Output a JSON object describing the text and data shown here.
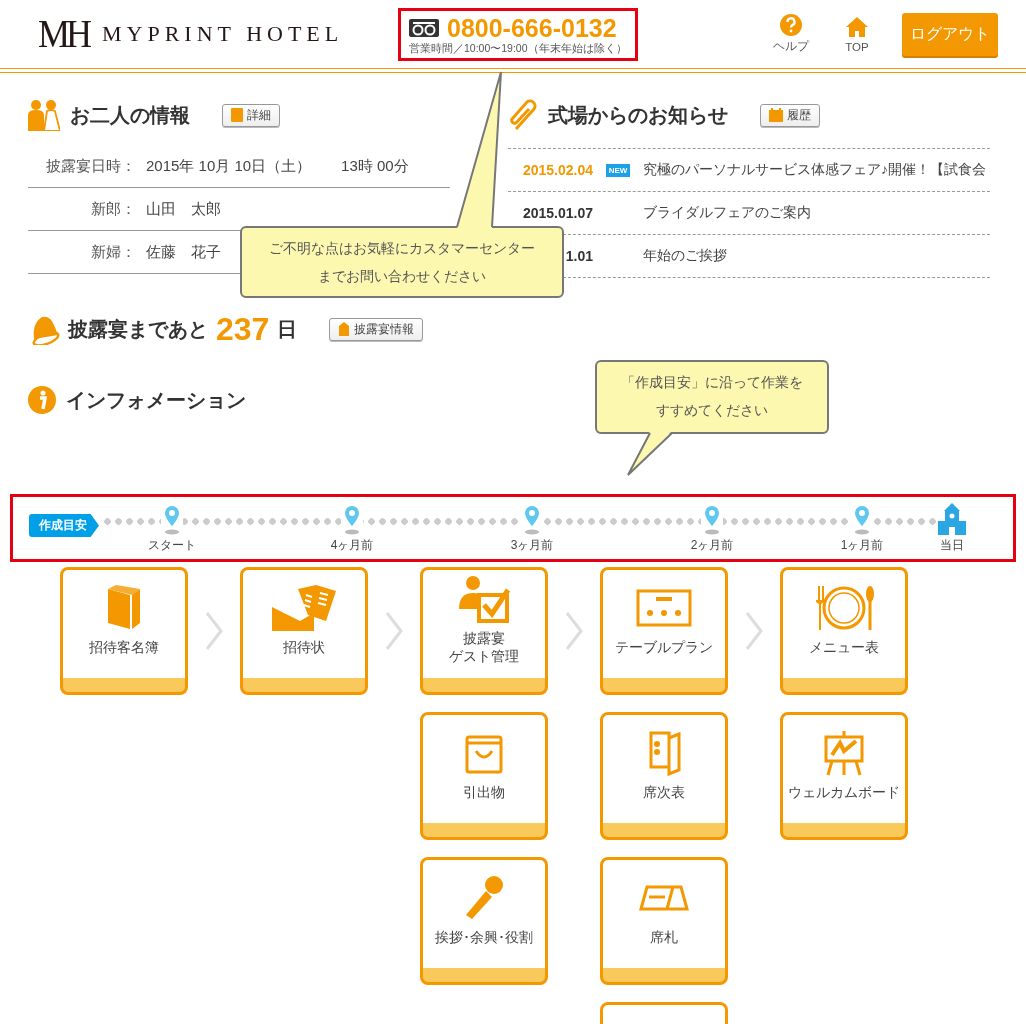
{
  "header": {
    "logo_mark": "MH",
    "logo_text": "MYPRINT HOTEL",
    "phone": "0800-666-0132",
    "hours": "営業時間／10:00〜19:00（年末年始は除く）",
    "nav": [
      {
        "label": "ヘルプ"
      },
      {
        "label": "TOP"
      }
    ],
    "logout": "ログアウト"
  },
  "couple": {
    "title": "お二人の情報",
    "button": "詳細",
    "rows": [
      {
        "label": "披露宴日時：",
        "value": "2015年 10月 10日（土）",
        "time": "13時 00分"
      },
      {
        "label": "新郎：",
        "value": "山田　太郎"
      },
      {
        "label": "新婦：",
        "value": "佐藤　花子"
      }
    ]
  },
  "countdown": {
    "prefix": "披露宴まであと",
    "days": "237",
    "suffix": "日",
    "button": "披露宴情報"
  },
  "info": {
    "title": "インフォメーション"
  },
  "news": {
    "title": "式場からのお知らせ",
    "button": "履歴",
    "items": [
      {
        "date": "2015.02.04",
        "new": true,
        "badge": "NEW",
        "text": "究極のパーソナルサービス体感フェア♪開催！【試食会"
      },
      {
        "date": "2015.01.07",
        "new": false,
        "text": "ブライダルフェアのご案内"
      },
      {
        "date": "1.01",
        "new": false,
        "text": "年始のご挨拶"
      }
    ]
  },
  "tooltips": [
    {
      "text": "ご不明な点はお気軽にカスタマーセンターまでお問い合わせください"
    },
    {
      "text": "「作成目安」に沿って作業をすすめてください"
    }
  ],
  "timeline": {
    "badge": "作成目安",
    "steps": [
      {
        "label": "スタート",
        "kind": "pin"
      },
      {
        "label": "4ヶ月前",
        "kind": "pin"
      },
      {
        "label": "3ヶ月前",
        "kind": "pin"
      },
      {
        "label": "2ヶ月前",
        "kind": "pin"
      },
      {
        "label": "1ヶ月前",
        "kind": "pin"
      },
      {
        "label": "当日",
        "kind": "goal"
      }
    ]
  },
  "tile_columns": [
    {
      "tiles": [
        {
          "lines": [
            "招待客名簿"
          ]
        }
      ]
    },
    {
      "tiles": [
        {
          "lines": [
            "招待状"
          ]
        }
      ]
    },
    {
      "tiles": [
        {
          "lines": [
            "披露宴",
            "ゲスト管理"
          ]
        },
        {
          "lines": [
            "引出物"
          ]
        },
        {
          "lines": [
            "挨拶･余興･役割"
          ]
        }
      ]
    },
    {
      "tiles": [
        {
          "lines": [
            "テーブルプラン"
          ]
        },
        {
          "lines": [
            "席次表"
          ]
        },
        {
          "lines": [
            "席札"
          ]
        },
        {
          "kind": "partial"
        }
      ]
    },
    {
      "tiles": [
        {
          "lines": [
            "メニュー表"
          ]
        },
        {
          "lines": [
            "ウェルカムボード"
          ]
        }
      ]
    }
  ]
}
